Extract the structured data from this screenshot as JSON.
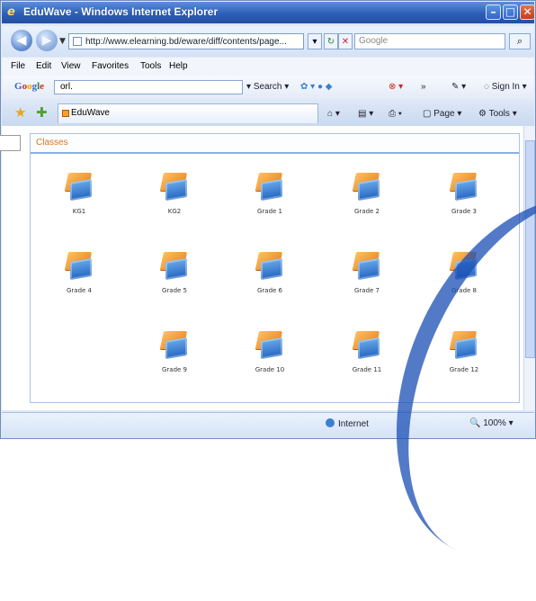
{
  "window": {
    "title": "EduWave - Windows Internet Explorer",
    "controls": {
      "minimize": "–",
      "maximize": "□",
      "close": "✕"
    }
  },
  "address_bar": {
    "url": "http://www.elearning.bd/eware/diff/contents/page...",
    "search_placeholder": "Google",
    "refresh_label": "↻",
    "stop_label": "✕",
    "search_button": "⌕"
  },
  "menu": [
    "File",
    "Edit",
    "View",
    "Favorites",
    "Tools",
    "Help"
  ],
  "google_toolbar": {
    "logo": [
      "G",
      "o",
      "o",
      "g",
      "l",
      "e"
    ],
    "query": "orl.",
    "search_label": "Search",
    "sign_in": "Sign In",
    "extra": "»"
  },
  "tab_bar": {
    "tab_label": "EduWave",
    "tools": [
      "Page",
      "Tools"
    ]
  },
  "panel": {
    "title": "Classes",
    "items": [
      {
        "label": "KG1"
      },
      {
        "label": "KG2"
      },
      {
        "label": "Grade 1"
      },
      {
        "label": "Grade 2"
      },
      {
        "label": "Grade 3"
      },
      {
        "label": "Grade 4"
      },
      {
        "label": "Grade 5"
      },
      {
        "label": "Grade 6"
      },
      {
        "label": "Grade 7"
      },
      {
        "label": "Grade 8"
      },
      {
        "label": "Grade 9"
      },
      {
        "label": "Grade 10"
      },
      {
        "label": "Grade 11"
      },
      {
        "label": "Grade 12"
      }
    ]
  },
  "status_bar": {
    "zone": "Internet",
    "zoom": "100%"
  },
  "colors": {
    "title_gradient_start": "#5d8fd8",
    "title_gradient_end": "#244f9f",
    "panel_title": "#e0731e",
    "book_orange": "#e57f18",
    "book_blue": "#2466c2"
  }
}
